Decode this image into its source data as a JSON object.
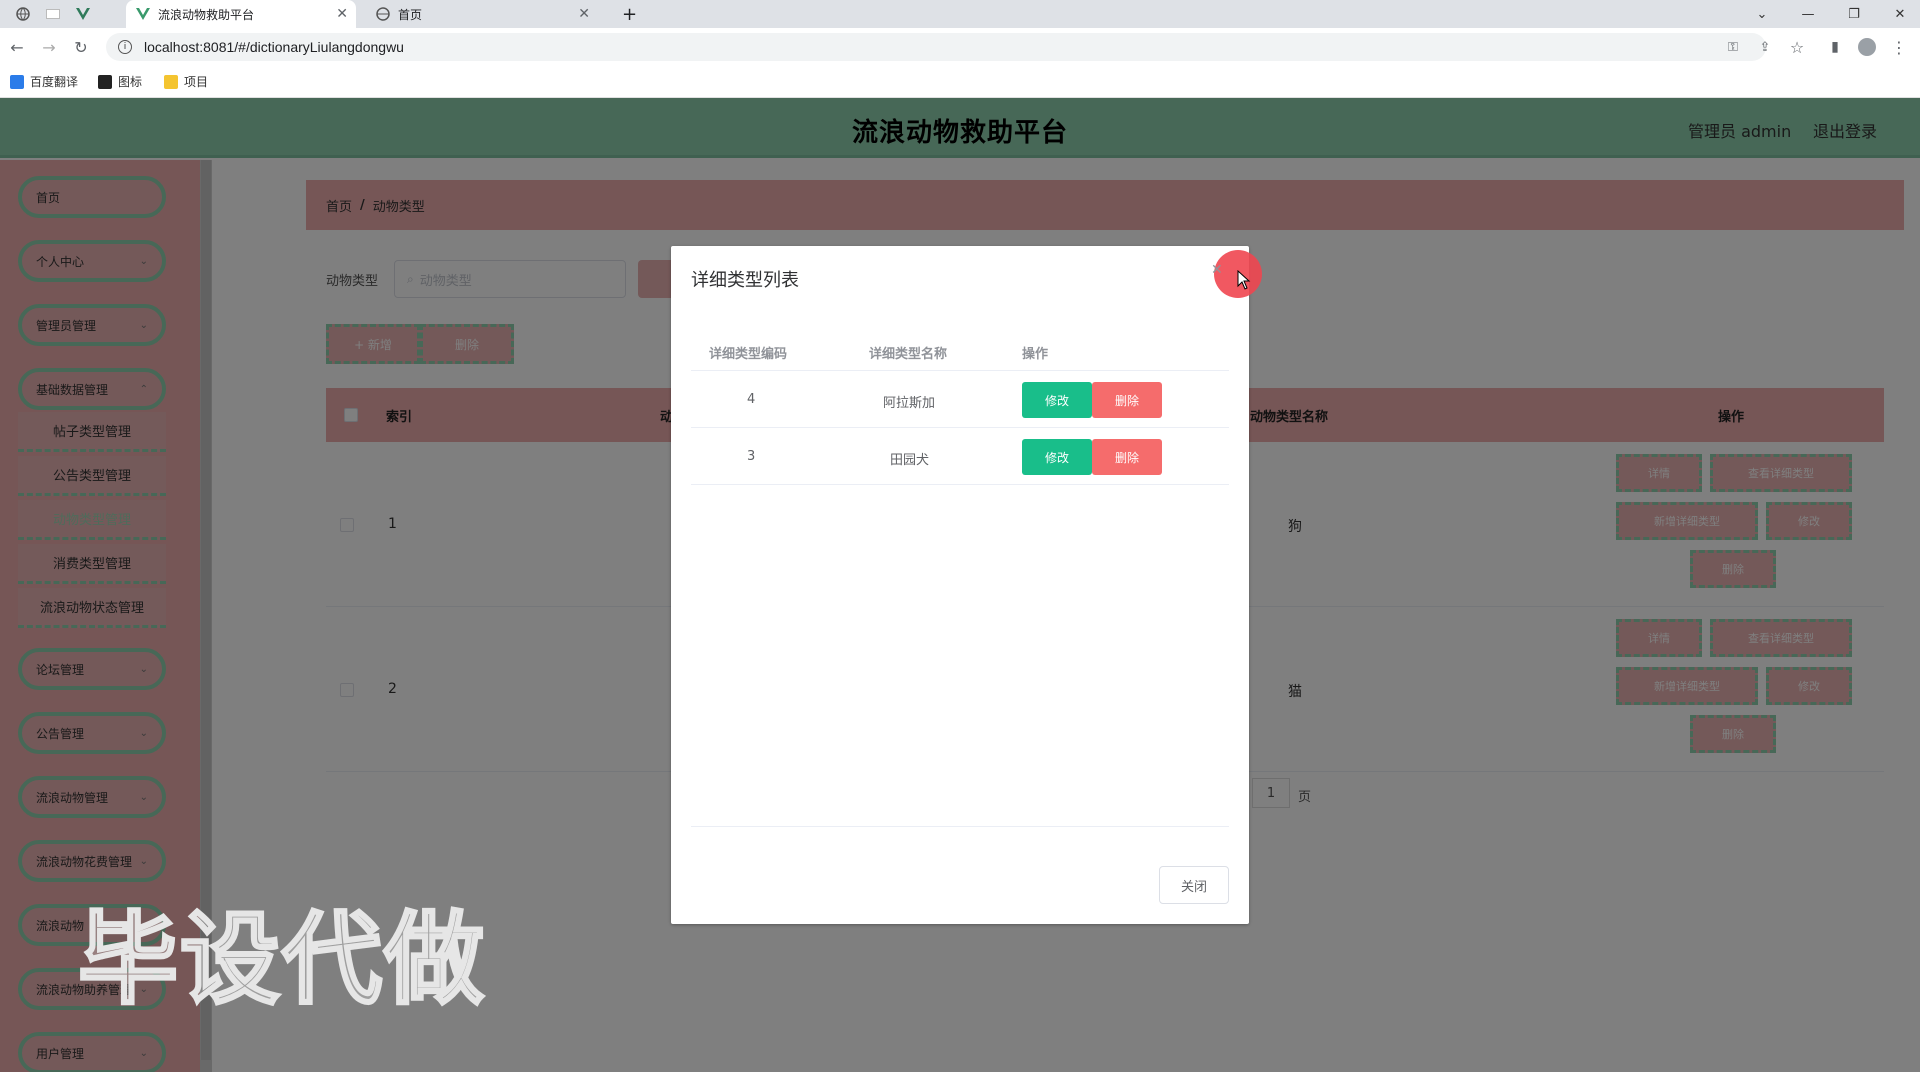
{
  "browser": {
    "tabs": [
      {
        "title": "流浪动物救助平台",
        "active": true
      },
      {
        "title": "首页",
        "active": false
      }
    ],
    "new_tab": "+",
    "url": "localhost:8081/#/dictionaryLiulangdongwu",
    "bookmarks": [
      "百度翻译",
      "图标",
      "项目"
    ]
  },
  "header": {
    "title": "流浪动物救助平台",
    "user": "管理员 admin",
    "logout": "退出登录"
  },
  "sidebar": {
    "menus": [
      {
        "label": "首页"
      },
      {
        "label": "个人中心"
      },
      {
        "label": "管理员管理"
      },
      {
        "label": "基础数据管理"
      }
    ],
    "submenus": [
      "帖子类型管理",
      "公告类型管理",
      "动物类型管理",
      "消费类型管理",
      "流浪动物状态管理"
    ],
    "menus2": [
      "论坛管理",
      "公告管理",
      "流浪动物管理",
      "流浪动物花费管理",
      "流浪动物",
      "流浪动物助养管理",
      "用户管理"
    ]
  },
  "breadcrumb": {
    "home": "首页",
    "sep": "/",
    "current": "动物类型"
  },
  "search": {
    "label": "动物类型",
    "placeholder": "动物类型"
  },
  "toolbar": {
    "add": "+ 新增",
    "delete": "删除"
  },
  "table": {
    "headers": {
      "index": "索引",
      "col2": "动",
      "name": "动物类型名称",
      "ops": "操作"
    },
    "rows": [
      {
        "index": "1",
        "name": "狗"
      },
      {
        "index": "2",
        "name": "猫"
      }
    ],
    "op_labels": {
      "detail": "详情",
      "view_detail": "查看详细类型",
      "add_detail": "新增详细类型",
      "edit": "修改",
      "delete": "删除"
    }
  },
  "pager": {
    "page": "1",
    "unit": "页"
  },
  "dialog": {
    "title": "详细类型列表",
    "headers": {
      "code": "详细类型编码",
      "name": "详细类型名称",
      "ops": "操作"
    },
    "rows": [
      {
        "code": "4",
        "name": "阿拉斯加"
      },
      {
        "code": "3",
        "name": "田园犬"
      }
    ],
    "edit_label": "修改",
    "delete_label": "删除",
    "close_label": "关闭"
  },
  "watermark": "毕设代做",
  "colors": {
    "header_green": "#8ed0ae",
    "pink": "#ecadad",
    "edit_green": "#19be8a",
    "delete_red": "#f56c6c"
  }
}
